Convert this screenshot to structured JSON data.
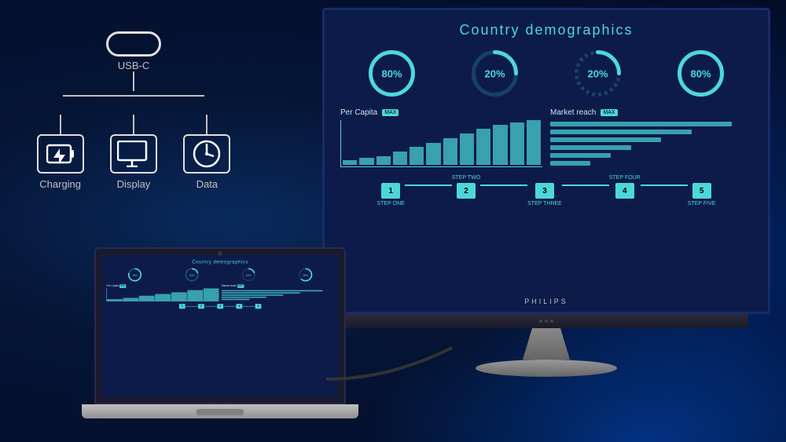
{
  "diagram": {
    "connector_label": "USB-C",
    "branches": [
      {
        "id": "charging",
        "label": "Charging",
        "icon": "⚡"
      },
      {
        "id": "display",
        "label": "Display",
        "icon": "🖥"
      },
      {
        "id": "data",
        "label": "Data",
        "icon": "⏱"
      }
    ]
  },
  "dashboard": {
    "title": "Country demographics",
    "circles": [
      {
        "value": 80,
        "label": "80%"
      },
      {
        "value": 20,
        "label": "20%"
      },
      {
        "value": 20,
        "label": "20%"
      },
      {
        "value": 80,
        "label": "80%"
      }
    ],
    "charts": {
      "per_capita": {
        "title": "Per Capita",
        "bars": [
          10,
          15,
          20,
          25,
          35,
          45,
          55,
          65,
          75,
          80,
          90,
          100
        ]
      },
      "market_reach": {
        "title": "Market reach",
        "bars": [
          90,
          70,
          55,
          40,
          30,
          20
        ]
      }
    },
    "steps": [
      {
        "number": "1",
        "label_top": "",
        "label_bottom": "STEP ONE"
      },
      {
        "number": "2",
        "label_top": "STEP TWO",
        "label_bottom": ""
      },
      {
        "number": "3",
        "label_top": "",
        "label_bottom": "STEP THREE"
      },
      {
        "number": "4",
        "label_top": "STEP FOUR",
        "label_bottom": ""
      },
      {
        "number": "5",
        "label_top": "",
        "label_bottom": "STEP FIVE"
      }
    ]
  },
  "brand": {
    "name": "PHILIPS",
    "accent_color": "#4dd8d8",
    "bg_color": "#0d1b4b"
  }
}
